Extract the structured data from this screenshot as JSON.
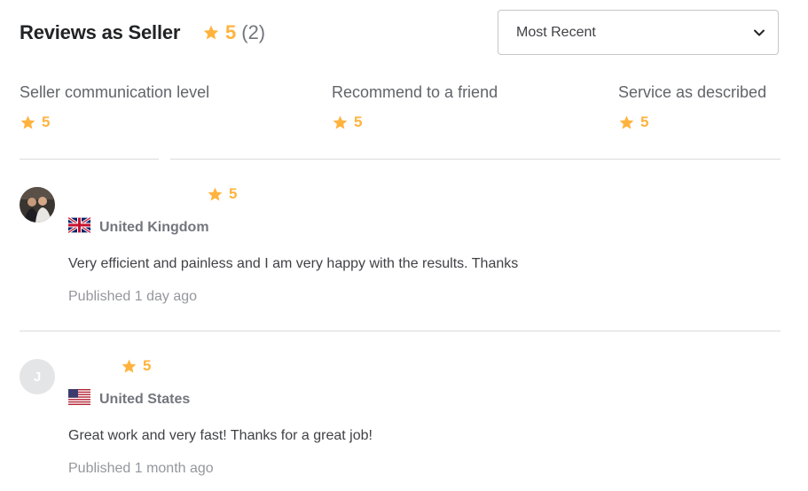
{
  "header": {
    "title": "Reviews as Seller",
    "rating": "5",
    "count": "(2)",
    "star_icon": "star-icon"
  },
  "sort": {
    "selected": "Most Recent",
    "icon": "chevron-down-icon"
  },
  "categories": [
    {
      "label": "Seller communication level",
      "rating": "5"
    },
    {
      "label": "Recommend to a friend",
      "rating": "5"
    },
    {
      "label": "Service as described",
      "rating": "5"
    }
  ],
  "reviews": [
    {
      "avatar_type": "photo",
      "rating": "5",
      "country": "United Kingdom",
      "flag_icon": "uk-flag-icon",
      "text": "Very efficient and painless and I am very happy with the results. Thanks",
      "published_label": "Published",
      "published_time": "1 day ago"
    },
    {
      "avatar_type": "letter",
      "avatar_letter": "J",
      "rating": "5",
      "country": "United States",
      "flag_icon": "us-flag-icon",
      "text": "Great work and very fast! Thanks for a great job!",
      "published_label": "Published",
      "published_time": "1 month ago"
    }
  ],
  "colors": {
    "accent_star": "#ffb33e",
    "text_dark": "#222325",
    "text_muted": "#74767e",
    "divider": "#dadbdd"
  }
}
